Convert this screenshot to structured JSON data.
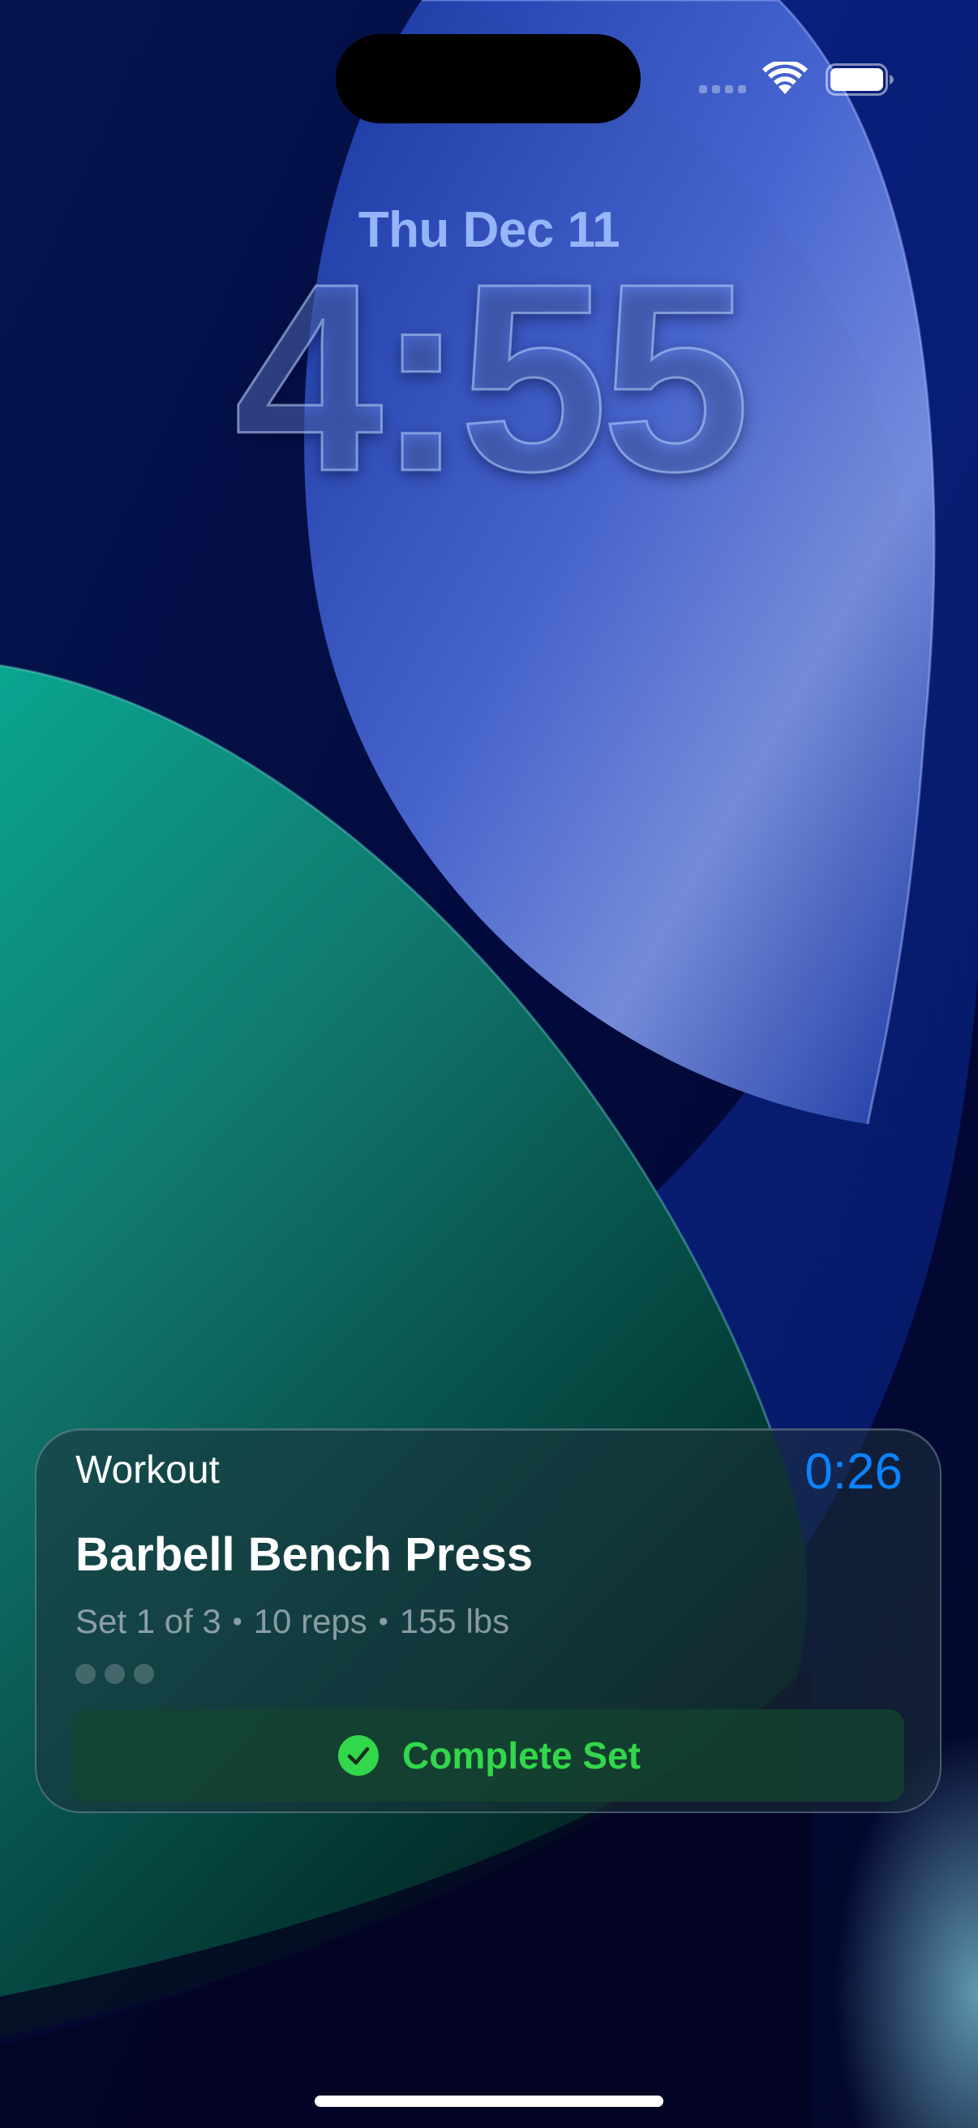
{
  "lock_screen": {
    "date": "Thu Dec 11",
    "time": "4:55"
  },
  "status_bar": {
    "icons": [
      "signal-dots-icon",
      "wifi-icon",
      "battery-icon"
    ]
  },
  "live_activity": {
    "app_name": "Workout",
    "timer": "0:26",
    "exercise": "Barbell Bench Press",
    "set_text": "Set 1 of 3",
    "reps_text": "10 reps",
    "weight_text": "155 lbs",
    "separator": "•",
    "progress": {
      "completed_sets": 0,
      "total_sets": 3
    },
    "action": {
      "label": "Complete Set",
      "icon": "checkmark-circle-icon"
    }
  },
  "colors": {
    "timer": "#0a84ff",
    "action_green": "#32d74b"
  }
}
